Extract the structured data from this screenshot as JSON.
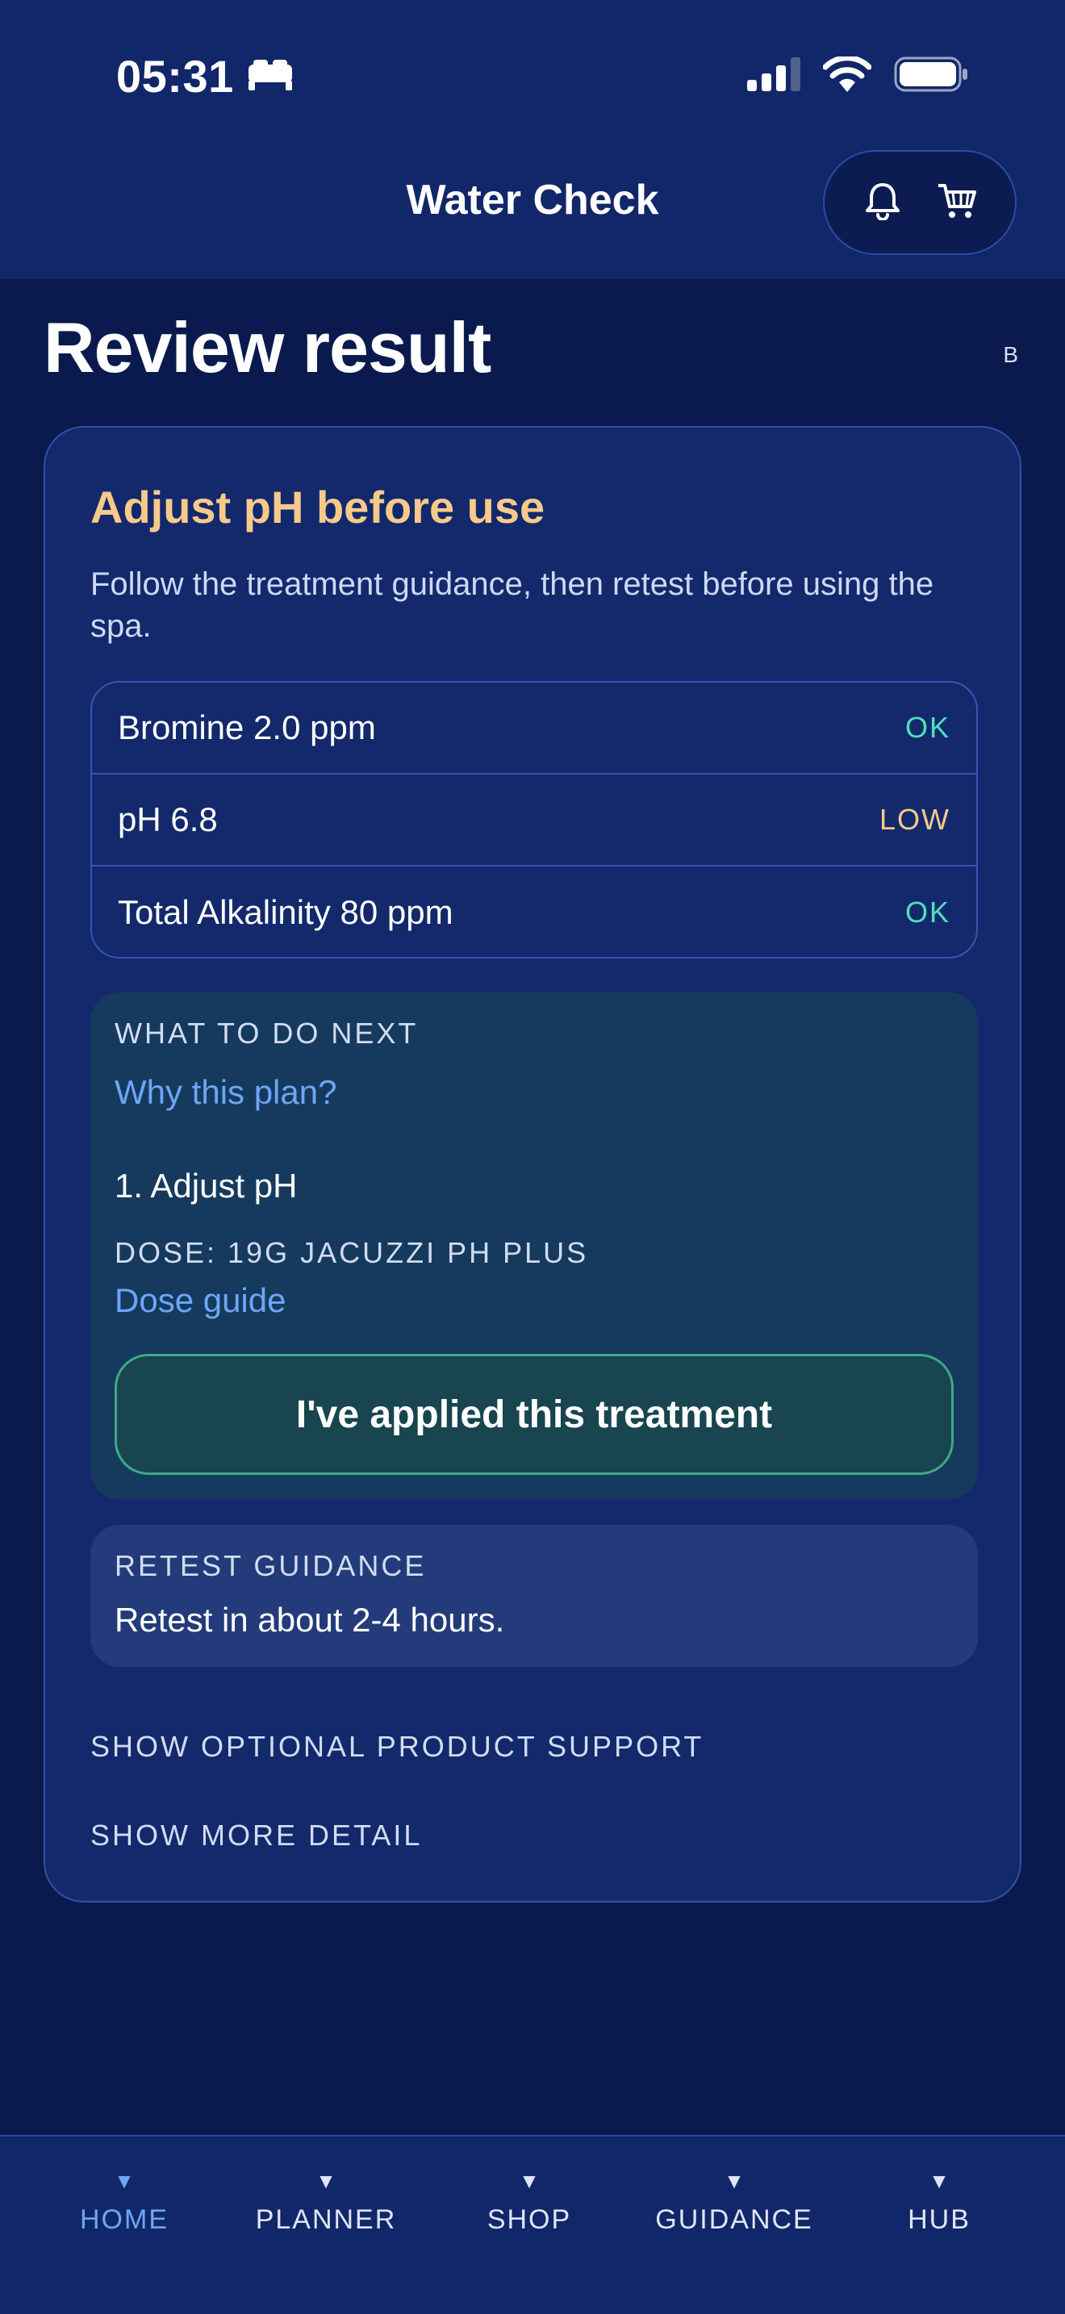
{
  "status_bar": {
    "time": "05:31"
  },
  "header": {
    "title": "Water Check"
  },
  "page": {
    "title": "Review result",
    "badge": "B"
  },
  "result": {
    "headline": "Adjust pH before use",
    "subtitle": "Follow the treatment guidance, then retest before using the spa.",
    "readings": [
      {
        "label": "Bromine 2.0 ppm",
        "status": "OK"
      },
      {
        "label": "pH 6.8",
        "status": "LOW"
      },
      {
        "label": "Total Alkalinity 80 ppm",
        "status": "OK"
      }
    ]
  },
  "next_steps": {
    "kicker": "WHAT TO DO NEXT",
    "why_link": "Why this plan?",
    "step": "1. Adjust pH",
    "dose": "DOSE: 19G JACUZZI PH PLUS",
    "dose_link": "Dose guide",
    "apply_button": "I've applied this treatment"
  },
  "retest": {
    "kicker": "RETEST GUIDANCE",
    "text": "Retest in about 2-4 hours."
  },
  "toggles": {
    "product_support": "SHOW OPTIONAL PRODUCT SUPPORT",
    "more_detail": "SHOW MORE DETAIL"
  },
  "tabs": [
    {
      "label": "HOME",
      "active": true
    },
    {
      "label": "PLANNER",
      "active": false
    },
    {
      "label": "SHOP",
      "active": false
    },
    {
      "label": "GUIDANCE",
      "active": false
    },
    {
      "label": "HUB",
      "active": false
    }
  ],
  "colors": {
    "background": "#0b1a4e",
    "card": "#13296c",
    "accent_link": "#6da6f5",
    "status_ok": "#4fe0b8",
    "status_low": "#f7c98a"
  }
}
